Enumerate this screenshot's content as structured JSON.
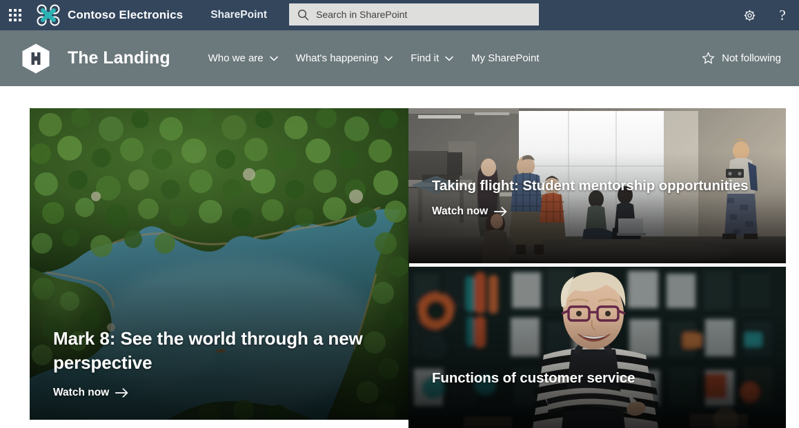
{
  "suite_bar": {
    "waffle_icon": "app-launcher-waffle-icon",
    "brand_logo_icon": "contoso-drone-logo-icon",
    "tenant_name": "Contoso Electronics",
    "suite_brand": "SharePoint",
    "search": {
      "icon": "search-icon",
      "placeholder": "Search in SharePoint",
      "value": ""
    },
    "settings_icon": "gear-icon",
    "help_icon": "question-mark-icon",
    "help_glyph": "?"
  },
  "site_header": {
    "site_logo_icon": "hexagon-h-logo-icon",
    "site_logo_letter": "H",
    "site_title": "The Landing",
    "nav_items": [
      {
        "label": "Who we are",
        "has_chevron": true,
        "icon": "chevron-down-icon"
      },
      {
        "label": "What's happening",
        "has_chevron": true,
        "icon": "chevron-down-icon"
      },
      {
        "label": "Find it",
        "has_chevron": true,
        "icon": "chevron-down-icon"
      },
      {
        "label": "My SharePoint",
        "has_chevron": false,
        "icon": ""
      }
    ],
    "follow": {
      "label": "Not following",
      "icon": "star-outline-icon"
    }
  },
  "hero": {
    "tiles": [
      {
        "headline": "Mark 8: See the world through a new perspective",
        "cta_label": "Watch now",
        "cta_arrow": "→",
        "image_description": "aerial-forest-lake"
      },
      {
        "headline": "Taking flight: Student mentorship opportunities",
        "cta_label": "Watch now",
        "cta_arrow": "→",
        "image_description": "classroom-students-drone"
      },
      {
        "headline": "Functions of customer service",
        "cta_label": "",
        "cta_arrow": "",
        "image_description": "retail-shop-employee"
      }
    ]
  },
  "colors": {
    "suite_bar_bg": "#33465c",
    "site_header_bg": "#6b787c",
    "search_bg": "#dededd",
    "brand_accent": "#2bb3b5",
    "page_bg": "#ffffff"
  }
}
